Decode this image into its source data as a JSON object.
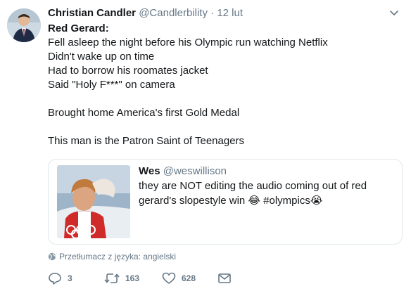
{
  "tweet": {
    "name": "Christian Candler",
    "handle": "@Candlerbility",
    "separator": "·",
    "time": "12 lut",
    "lines": [
      "Red Gerard:",
      "Fell asleep the night before his Olympic run watching Netflix",
      "Didn't wake up on time",
      "Had to borrow his roomates jacket",
      "Said \"Holy F***\" on camera",
      "Brought home America's first Gold Medal",
      "This man is the Patron Saint of Teenagers"
    ]
  },
  "quote": {
    "name": "Wes",
    "handle": "@weswillison",
    "text": "they are NOT editing the audio coming out of red gerard's slopestyle win 😂 #olympics😭"
  },
  "translate_label": "Przetłumacz z języka: angielski",
  "actions": {
    "replies": "3",
    "retweets": "163",
    "likes": "628"
  },
  "colors": {
    "text": "#14171a",
    "muted": "#657786",
    "border": "#e1e8ed"
  }
}
